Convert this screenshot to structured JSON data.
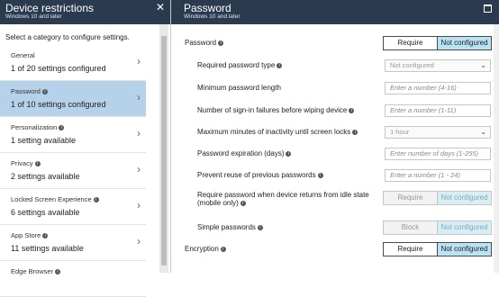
{
  "left": {
    "title": "Device restrictions",
    "subtitle": "Windows 10 and later",
    "instruction": "Select a category to configure settings.",
    "categories": [
      {
        "name": "General",
        "desc": "1 of 20 settings configured",
        "selected": false
      },
      {
        "name": "Password",
        "desc": "1 of 10 settings configured",
        "selected": true
      },
      {
        "name": "Personalization",
        "desc": "1 setting available",
        "selected": false
      },
      {
        "name": "Privacy",
        "desc": "2 settings available",
        "selected": false
      },
      {
        "name": "Locked Screen Experience",
        "desc": "6 settings available",
        "selected": false
      },
      {
        "name": "App Store",
        "desc": "11 settings available",
        "selected": false
      },
      {
        "name": "Edge Browser",
        "desc": "",
        "selected": false
      }
    ]
  },
  "right": {
    "title": "Password",
    "subtitle": "Windows 10 and later",
    "password_label": "Password",
    "password_toggle": {
      "a": "Require",
      "b": "Not configured"
    },
    "required_type_label": "Required password type",
    "required_type_value": "Not configured",
    "min_length_label": "Minimum password length",
    "min_length_placeholder": "Enter a number (4-16)",
    "signin_failures_label": "Number of sign-in failures before wiping device",
    "signin_failures_placeholder": "Enter a number (1-11)",
    "inactivity_label": "Maximum minutes of inactivity until screen locks",
    "inactivity_value": "1 hour",
    "expiration_label": "Password expiration (days)",
    "expiration_placeholder": "Enter number of days (1-255)",
    "reuse_label": "Prevent reuse of previous passwords",
    "reuse_placeholder": "Enter a number (1 - 24)",
    "idle_label_line1": "Require password when device returns from idle state",
    "idle_label_line2": "(mobile only)",
    "idle_toggle": {
      "a": "Require",
      "b": "Not configured"
    },
    "simple_label": "Simple passwords",
    "simple_toggle": {
      "a": "Block",
      "b": "Not configured"
    },
    "encryption_label": "Encryption",
    "encryption_toggle": {
      "a": "Require",
      "b": "Not configured"
    }
  }
}
